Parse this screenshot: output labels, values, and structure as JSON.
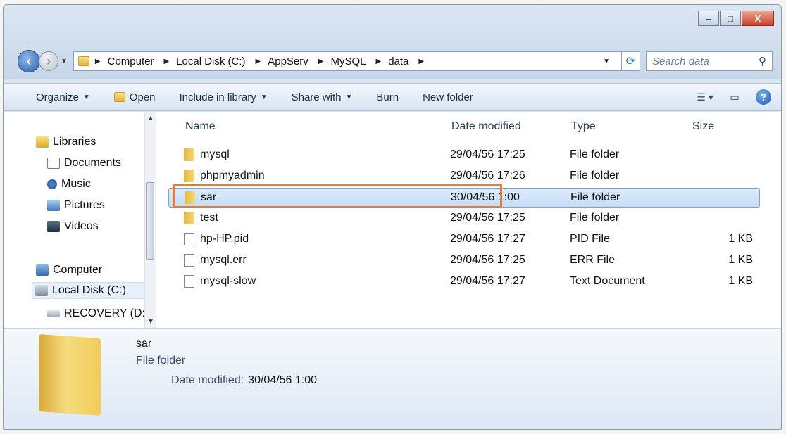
{
  "window": {
    "controls": [
      "minimize",
      "maximize",
      "close"
    ],
    "close_label": "X"
  },
  "address": {
    "breadcrumbs": [
      "Computer",
      "Local Disk (C:)",
      "AppServ",
      "MySQL",
      "data"
    ]
  },
  "search": {
    "placeholder": "Search data"
  },
  "toolbar": {
    "organize": "Organize",
    "open": "Open",
    "include": "Include in library",
    "share": "Share with",
    "burn": "Burn",
    "new_folder": "New folder"
  },
  "nav": {
    "libraries": "Libraries",
    "documents": "Documents",
    "music": "Music",
    "pictures": "Pictures",
    "videos": "Videos",
    "computer": "Computer",
    "local_disk": "Local Disk (C:)",
    "recovery": "RECOVERY (D:"
  },
  "columns": {
    "name": "Name",
    "date": "Date modified",
    "type": "Type",
    "size": "Size"
  },
  "files": [
    {
      "name": "mysql",
      "date": "29/04/56 17:25",
      "type": "File folder",
      "size": "",
      "kind": "folder"
    },
    {
      "name": "phpmyadmin",
      "date": "29/04/56 17:26",
      "type": "File folder",
      "size": "",
      "kind": "folder"
    },
    {
      "name": "sar",
      "date": "30/04/56 1:00",
      "type": "File folder",
      "size": "",
      "kind": "folder",
      "selected": true
    },
    {
      "name": "test",
      "date": "29/04/56 17:25",
      "type": "File folder",
      "size": "",
      "kind": "folder"
    },
    {
      "name": "hp-HP.pid",
      "date": "29/04/56 17:27",
      "type": "PID File",
      "size": "1 KB",
      "kind": "file"
    },
    {
      "name": "mysql.err",
      "date": "29/04/56 17:25",
      "type": "ERR File",
      "size": "1 KB",
      "kind": "file"
    },
    {
      "name": "mysql-slow",
      "date": "29/04/56 17:27",
      "type": "Text Document",
      "size": "1 KB",
      "kind": "file"
    }
  ],
  "details": {
    "name": "sar",
    "type": "File folder",
    "date_label": "Date modified:",
    "date_value": "30/04/56 1:00"
  },
  "colors": {
    "highlight": "#e07c3c",
    "selection": "#c4ddf7"
  }
}
